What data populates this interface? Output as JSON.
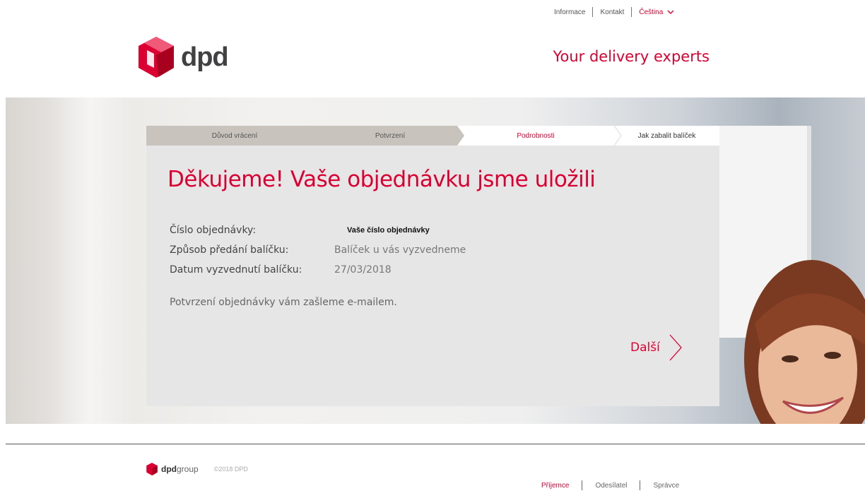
{
  "topnav": {
    "info": "Informace",
    "contact": "Kontakt",
    "language": "Čeština"
  },
  "brand": {
    "logo_text": "dpd",
    "tagline": "Your delivery experts",
    "accent_color": "#dc0032"
  },
  "steps": [
    {
      "label": "Důvod vrácení",
      "state": "done"
    },
    {
      "label": "Potvrzení",
      "state": "done"
    },
    {
      "label": "Podrobnosti",
      "state": "active"
    },
    {
      "label": "Jak zabalit balíček",
      "state": "pending"
    }
  ],
  "confirmation": {
    "title": "Děkujeme! Vaše objednávku jsme uložili",
    "fields": [
      {
        "label": "Číslo objednávky:",
        "value": "Vaše číslo objednávky"
      },
      {
        "label": "Způsob předání balíčku:",
        "value": "Balíček u vás vyzvedneme"
      },
      {
        "label": "Datum vyzvednutí balíčku:",
        "value": "27/03/2018"
      }
    ],
    "note": "Potvrzení objednávky vám zašleme e-mailem.",
    "next_label": "Další"
  },
  "footer": {
    "logo_bold": "dpd",
    "logo_light": "group",
    "copyright": "©2018 DPD",
    "nav": [
      "Příjemce",
      "Odesílatel",
      "Správce"
    ]
  }
}
